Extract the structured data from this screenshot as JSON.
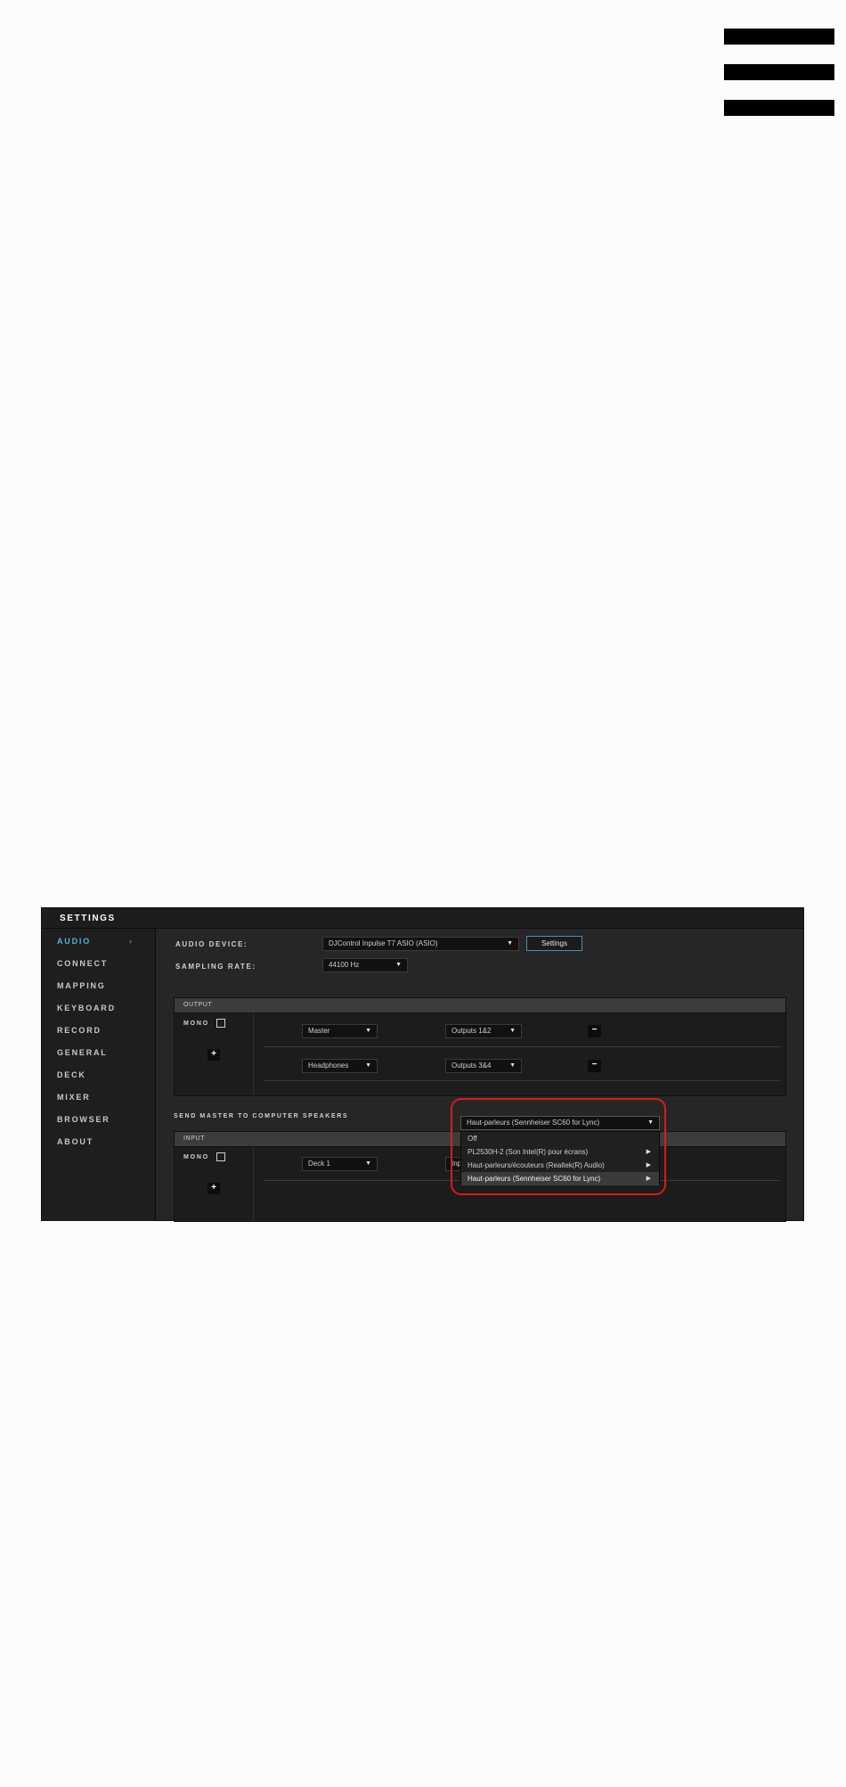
{
  "hamburger": {
    "icon": "hamburger-menu-icon"
  },
  "settings": {
    "title": "SETTINGS",
    "sidebar": {
      "items": [
        {
          "label": "AUDIO",
          "active": true
        },
        {
          "label": "CONNECT"
        },
        {
          "label": "MAPPING"
        },
        {
          "label": "KEYBOARD"
        },
        {
          "label": "RECORD"
        },
        {
          "label": "GENERAL"
        },
        {
          "label": "DECK"
        },
        {
          "label": "MIXER"
        },
        {
          "label": "BROWSER"
        },
        {
          "label": "ABOUT"
        }
      ],
      "active_arrow": "›"
    },
    "audio_device": {
      "label": "AUDIO DEVICE:",
      "value": "DJControl Inpulse T7 ASIO (ASIO)",
      "settings_button": "Settings"
    },
    "sampling_rate": {
      "label": "SAMPLING RATE:",
      "value": "44100 Hz"
    },
    "output": {
      "header": "OUTPUT",
      "mono_label": "MONO",
      "add_label": "+",
      "rows": [
        {
          "source": "Master",
          "destination": "Outputs 1&2",
          "remove_label": "−"
        },
        {
          "source": "Headphones",
          "destination": "Outputs 3&4",
          "remove_label": "−"
        }
      ]
    },
    "send_master": {
      "label": "SEND MASTER TO COMPUTER SPEAKERS",
      "value": "Haut-parleurs (Sennheiser SC60 for Lync)",
      "options": [
        {
          "label": "Off"
        },
        {
          "label": "PL2530H-2 (Son Intel(R) pour écrans)",
          "submenu": true
        },
        {
          "label": "Haut-parleurs/écouteurs (Realtek(R) Audio)",
          "submenu": true
        },
        {
          "label": "Haut-parleurs (Sennheiser SC60 for Lync)",
          "submenu": true,
          "selected": true
        }
      ]
    },
    "input": {
      "header": "INPUT",
      "mono_label": "MONO",
      "add_label": "+",
      "rows": [
        {
          "source": "Deck 1",
          "destination_partial": "Inp"
        }
      ]
    },
    "colors": {
      "accent": "#4fb4e6",
      "highlight_ring": "#d91b1b",
      "panel_bg": "#262626"
    }
  }
}
